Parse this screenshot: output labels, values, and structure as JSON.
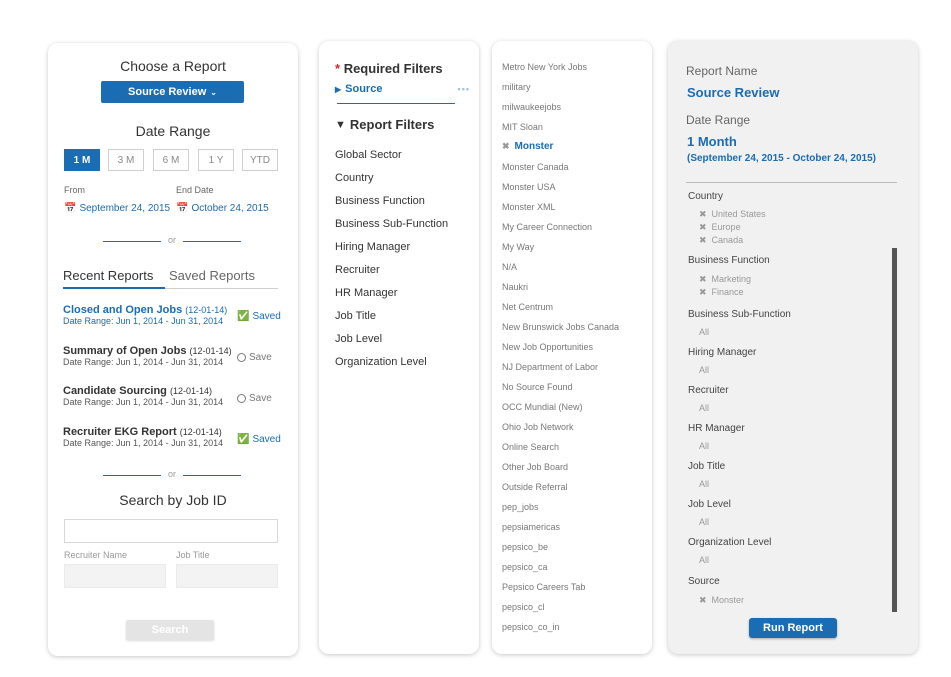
{
  "choose_report": {
    "title": "Choose a Report",
    "selected_report": "Source Review",
    "date_range_title": "Date Range",
    "ranges": [
      "1 M",
      "3 M",
      "6 M",
      "1 Y",
      "YTD"
    ],
    "active_range": "1 M",
    "from_label": "From",
    "end_label": "End Date",
    "from_date": "September 24, 2015",
    "end_date": "October 24, 2015",
    "or": "or"
  },
  "reports_tabs": {
    "recent": "Recent Reports",
    "saved": "Saved Reports"
  },
  "recent_reports": [
    {
      "title": "Closed and Open Jobs",
      "date_code": "(12-01-14)",
      "range": "Date Range: Jun 1, 2014 - Jun 31, 2014",
      "action": "Saved"
    },
    {
      "title": "Summary of Open Jobs",
      "date_code": "(12-01-14)",
      "range": "Date Range: Jun 1, 2014 - Jun 31, 2014",
      "action": "Save"
    },
    {
      "title": "Candidate Sourcing",
      "date_code": "(12-01-14)",
      "range": "Date Range: Jun 1, 2014 - Jun 31, 2014",
      "action": "Save"
    },
    {
      "title": "Recruiter EKG Report",
      "date_code": "(12-01-14)",
      "range": "Date Range: Jun 1, 2014 - Jun 31, 2014",
      "action": "Saved"
    }
  ],
  "search_by_job": {
    "or": "or",
    "title": "Search by Job ID",
    "recruiter_label": "Recruiter Name",
    "job_title_label": "Job Title",
    "search_button": "Search"
  },
  "filters": {
    "required_star": "*",
    "required_title": "Required Filters",
    "source_item": "Source",
    "more_dots": "•••",
    "report_filters_title": "Report Filters",
    "items": [
      "Global Sector",
      "Country",
      "Business Function",
      "Business Sub-Function",
      "Hiring Manager",
      "Recruiter",
      "HR Manager",
      "Job Title",
      "Job Level",
      "Organization Level"
    ]
  },
  "sources": [
    "Metro New York Jobs",
    "military",
    "milwaukeejobs",
    "MIT Sloan",
    "Monster",
    "Monster Canada",
    "Monster USA",
    "Monster XML",
    "My Career Connection",
    "My Way",
    "N/A",
    "Naukri",
    "Net Centrum",
    "New Brunswick Jobs Canada",
    "New Job Opportunities",
    "NJ Department of Labor",
    "No Source Found",
    "OCC Mundial (New)",
    "Ohio Job Network",
    "Online Search",
    "Other Job Board",
    "Outside Referral",
    "pep_jobs",
    "pepsiamericas",
    "pepsico_be",
    "pepsico_ca",
    "Pepsico Careers Tab",
    "pepsico_cl",
    "pepsico_co_in"
  ],
  "selected_source": "Monster",
  "summary": {
    "report_name_label": "Report Name",
    "report_name": "Source Review",
    "date_range_label": "Date Range",
    "date_value": "1 Month",
    "date_sub": "(September 24, 2015 - October 24, 2015)",
    "categories": [
      {
        "name": "Country",
        "values": [
          "United States",
          "Europe",
          "Canada"
        ],
        "removable": true
      },
      {
        "name": "Business Function",
        "values": [
          "Marketing",
          "Finance"
        ],
        "removable": true
      },
      {
        "name": "Business Sub-Function",
        "values": [
          "All"
        ],
        "removable": false
      },
      {
        "name": "Hiring Manager",
        "values": [
          "All"
        ],
        "removable": false
      },
      {
        "name": "Recruiter",
        "values": [
          "All"
        ],
        "removable": false
      },
      {
        "name": "HR Manager",
        "values": [
          "All"
        ],
        "removable": false
      },
      {
        "name": "Job Title",
        "values": [
          "All"
        ],
        "removable": false
      },
      {
        "name": "Job Level",
        "values": [
          "All"
        ],
        "removable": false
      },
      {
        "name": "Organization Level",
        "values": [
          "All"
        ],
        "removable": false
      },
      {
        "name": "Source",
        "values": [
          "Monster"
        ],
        "removable": true
      }
    ],
    "run_button": "Run Report"
  },
  "colors": {
    "accent": "#1a6cb3",
    "panel_grey": "#f1f1f1",
    "star_red": "#d9262c"
  }
}
